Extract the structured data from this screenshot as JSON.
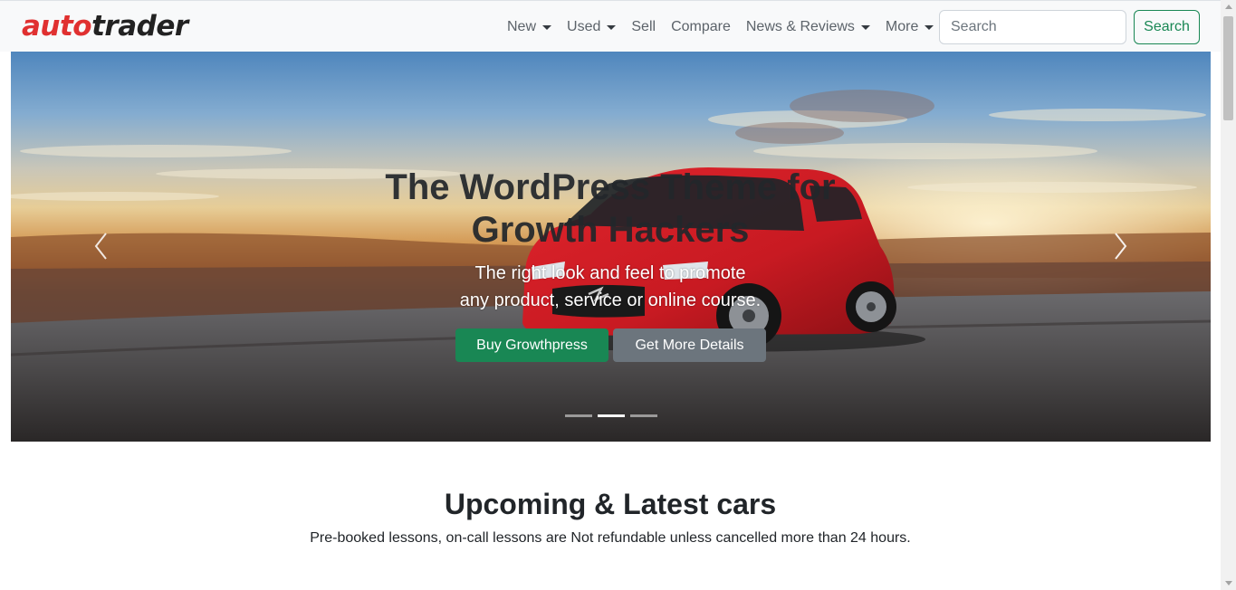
{
  "brand": {
    "part1": "auto",
    "part2": "trader"
  },
  "nav": {
    "items": [
      {
        "label": "New",
        "dropdown": true
      },
      {
        "label": "Used",
        "dropdown": true
      },
      {
        "label": "Sell",
        "dropdown": false
      },
      {
        "label": "Compare",
        "dropdown": false
      },
      {
        "label": "News & Reviews",
        "dropdown": true
      },
      {
        "label": "More",
        "dropdown": true
      }
    ],
    "search_placeholder": "Search",
    "search_button": "Search"
  },
  "hero": {
    "title": "The WordPress Theme for Growth Hackers",
    "subtitle_line1": "The right look and feel to promote",
    "subtitle_line2": "any product, service or online course.",
    "buy_button": "Buy Growthpress",
    "details_button": "Get More Details",
    "car_badge": "SWIFT",
    "active_slide": 2,
    "slide_count": 3
  },
  "section": {
    "title": "Upcoming & Latest cars",
    "text": "Pre-booked lessons, on-call lessons are Not refundable unless cancelled more than 24 hours."
  },
  "colors": {
    "brand_red": "#e03030",
    "success": "#198754",
    "secondary": "#6c757d",
    "navbar_bg": "#f8f9fa"
  },
  "icons": {
    "nav_caret": "caret-down-icon",
    "carousel_prev": "chevron-left-icon",
    "carousel_next": "chevron-right-icon"
  }
}
